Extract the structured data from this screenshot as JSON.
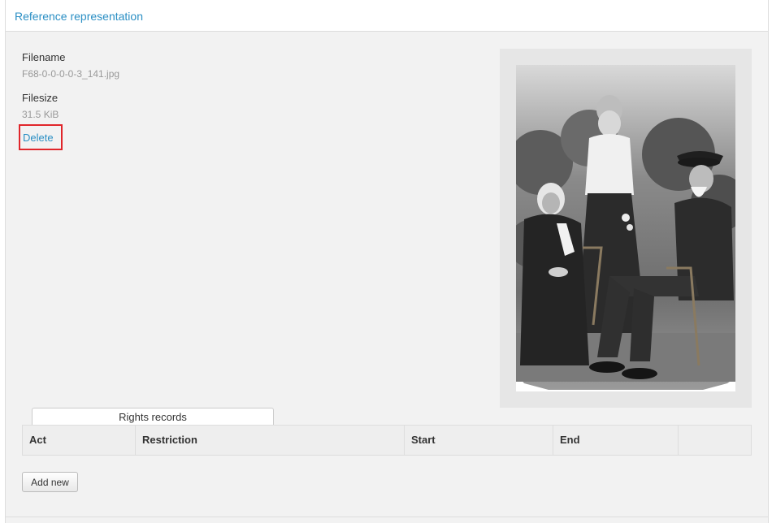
{
  "header": {
    "title": "Reference representation"
  },
  "file": {
    "filename_label": "Filename",
    "filename_value": "F68-0-0-0-0-3_141.jpg",
    "filesize_label": "Filesize",
    "filesize_value": "31.5 KiB",
    "delete_label": "Delete"
  },
  "rights": {
    "tab_label": "Rights records",
    "columns": [
      "Act",
      "Restriction",
      "Start",
      "End",
      ""
    ],
    "add_new_label": "Add new"
  },
  "colors": {
    "link": "#2b8fc4",
    "highlight": "#e0262b"
  }
}
